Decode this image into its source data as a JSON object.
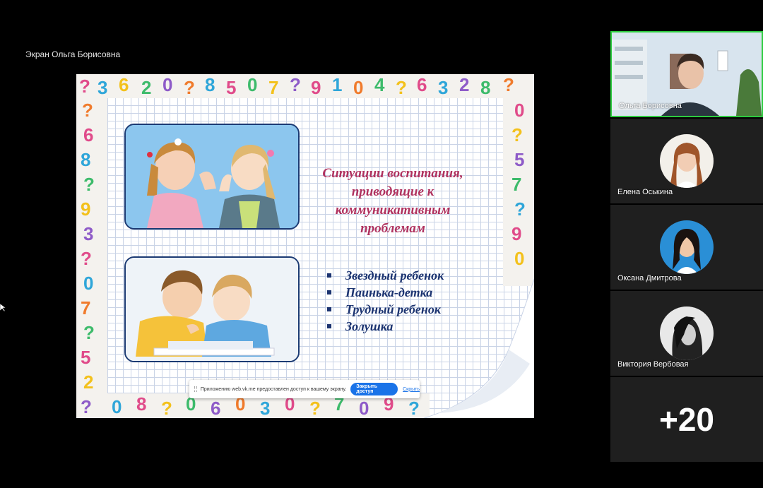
{
  "screen_share": {
    "label": "Экран Ольга Борисовна"
  },
  "slide": {
    "title_lines": [
      "Ситуации воспитания,",
      "приводящие к",
      "коммуникативным",
      "проблемам"
    ],
    "bullets": [
      "Звездный ребенок",
      "Паинька-детка",
      "Трудный ребенок",
      "Золушка"
    ],
    "title_color": "#b0325f",
    "bullet_color": "#1b3370"
  },
  "share_banner": {
    "text": "Приложению web.vk.me предоставлен доступ к вашему экрану.",
    "stop_label": "Закрыть доступ",
    "hide_label": "Скрыть"
  },
  "participants": [
    {
      "name": "Ольга Борисовна",
      "active_speaker": true
    },
    {
      "name": "Елена Оськина"
    },
    {
      "name": "Оксана Дмитрова"
    },
    {
      "name": "Виктория Вербовая"
    }
  ],
  "more_participants": "+20",
  "colors": {
    "active_border": "#2ecc40",
    "tile_bg": "#1f1f1f",
    "accent_button": "#1a73e8"
  }
}
